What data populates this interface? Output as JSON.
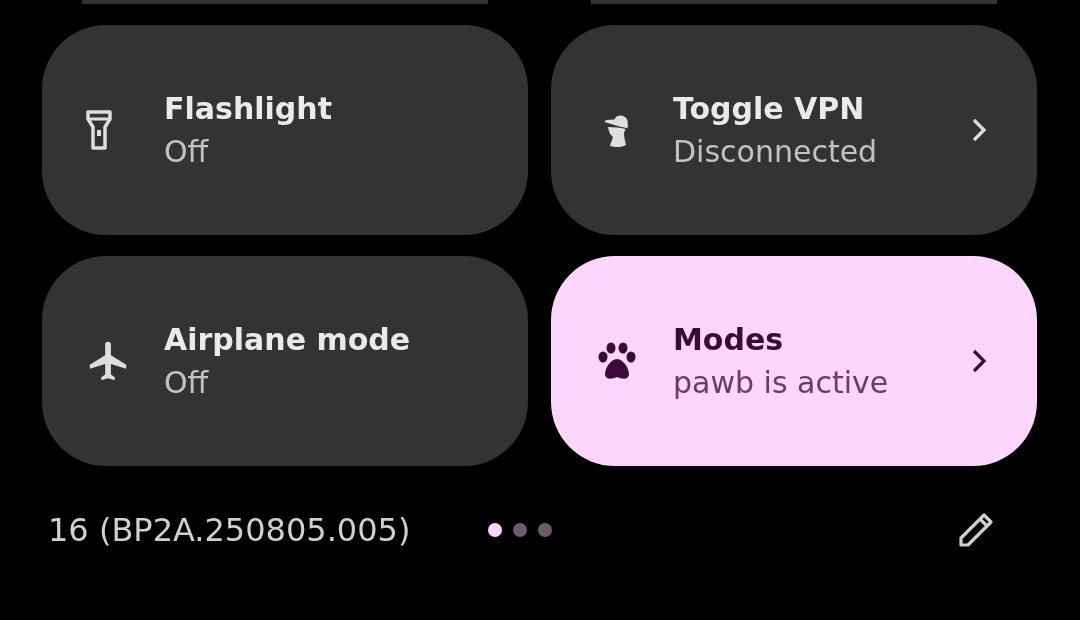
{
  "tiles": [
    {
      "title": "Flashlight",
      "subtitle": "Off",
      "kind": "flashlight",
      "active": false,
      "chevron": false
    },
    {
      "title": "Toggle VPN",
      "subtitle": "Disconnected",
      "kind": "vpn",
      "active": false,
      "chevron": true
    },
    {
      "title": "Airplane mode",
      "subtitle": "Off",
      "kind": "airplane",
      "active": false,
      "chevron": false
    },
    {
      "title": "Modes",
      "subtitle": "pawb is active",
      "kind": "paw",
      "active": true,
      "chevron": true
    }
  ],
  "footer": {
    "build": "16 (BP2A.250805.005)",
    "pages": [
      {
        "selected": true
      },
      {
        "selected": false
      },
      {
        "selected": false
      }
    ]
  }
}
